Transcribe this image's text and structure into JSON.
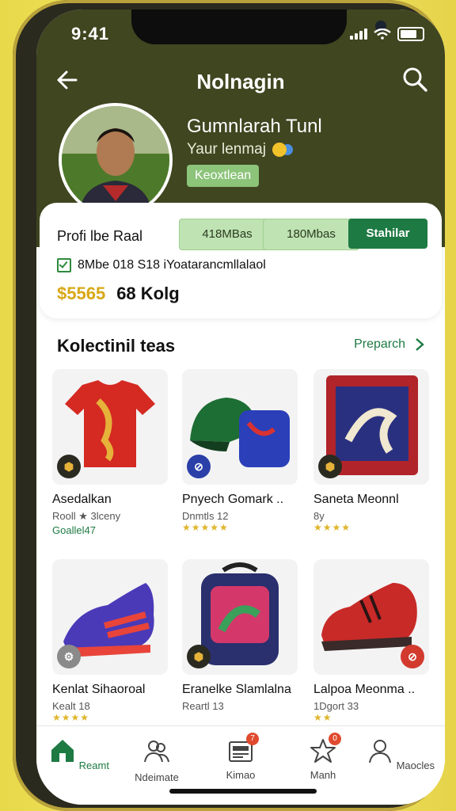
{
  "status": {
    "time": "9:41"
  },
  "nav": {
    "title": "Nolnagin"
  },
  "user": {
    "name": "Gumnlarah Tunl",
    "subtitle": "Yaur lenmaj",
    "badge": "Keoxtlean"
  },
  "panel": {
    "profile_label": "Profi lbe Raal",
    "chip_a": "418MBas",
    "chip_b": "180Mbas",
    "chip_c": "Stahilar",
    "check_text": "8Mbe 018 S18 iYoatarancmllalaol",
    "coins": "$5565",
    "coins_unit": "68 Kolg"
  },
  "section": {
    "title": "Kolectinil teas",
    "link": "Preparch"
  },
  "cards": [
    {
      "name": "Asedalkan",
      "meta": "Rooll ★ 3lceny",
      "extra": "Goallel47",
      "tag_color": "#2a2a20"
    },
    {
      "name": "Pnyech Gomark ..",
      "meta": "Dnmtls 12",
      "stars": "★★★★★",
      "tag_color": "#2a3fa8"
    },
    {
      "name": "Saneta Meonnl",
      "meta": "8y",
      "stars": "★★★★",
      "tag_color": "#2a2a20"
    },
    {
      "name": "Kenlat Sihaoroal",
      "meta": "Kealt 18",
      "stars": "★★★★",
      "tag_color": "#8a8a8a"
    },
    {
      "name": "Eranelke Slamlalna",
      "meta": "Reartl 13",
      "tag_color": "#2a2a20"
    },
    {
      "name": "Lalpoa Meonma ..",
      "meta": "1Dgort 33",
      "stars": "★★",
      "tag_color": "#d23a2e"
    }
  ],
  "tabs": [
    {
      "label": "Reamt",
      "icon": "home-icon",
      "active": true
    },
    {
      "label": "Ndeimate",
      "icon": "friends-icon"
    },
    {
      "label": "Kimao",
      "icon": "inbox-icon",
      "badge": "7"
    },
    {
      "label": "Manh",
      "icon": "star-icon",
      "badge": "0"
    },
    {
      "label": "Maocles",
      "icon": "profile-icon"
    }
  ],
  "colors": {
    "header": "#3f4620",
    "accent": "#1e7a43",
    "chip": "#bfe3b3"
  }
}
